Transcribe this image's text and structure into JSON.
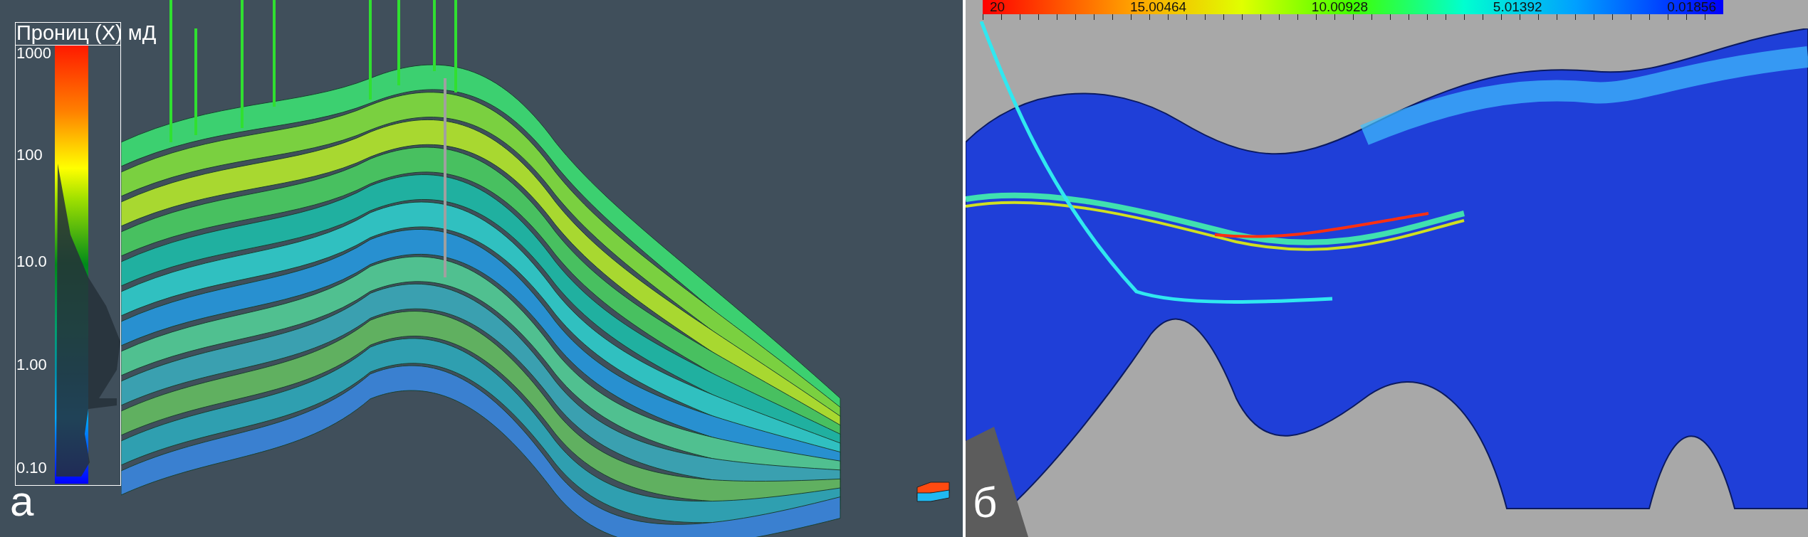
{
  "left_panel": {
    "legend": {
      "title": "Прониц (X) мД",
      "ticks": [
        "1000",
        "100",
        "10.0",
        "1.00",
        "0.10"
      ]
    },
    "panel_label": "а"
  },
  "right_panel": {
    "color_bar": {
      "labels": [
        "20",
        "15.00464",
        "10.00928",
        "5.01392",
        "0.01856"
      ]
    },
    "panel_label": "б"
  }
}
